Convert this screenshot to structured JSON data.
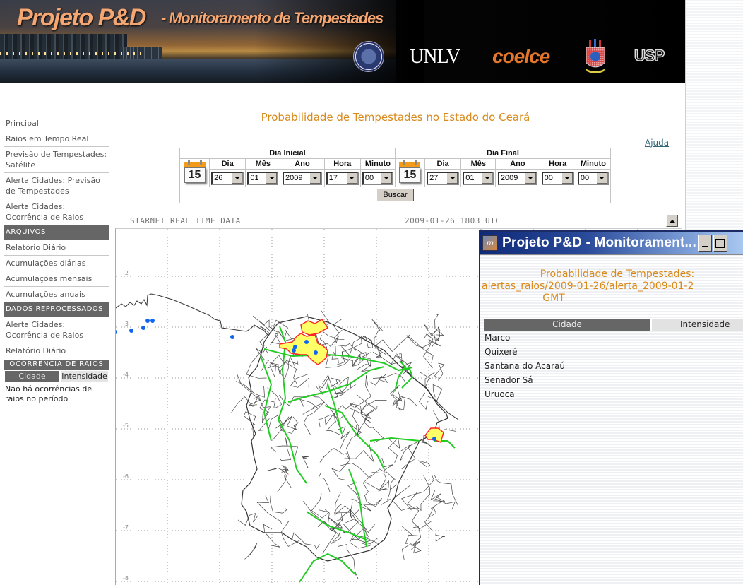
{
  "banner": {
    "title": "Projeto P&D",
    "subtitle": "- Monitoramento de Tempestades",
    "logos": [
      "UConn seal",
      "UNLV",
      "coelce",
      "UFC crest",
      "USP"
    ],
    "logo_unlv": "UNLV",
    "logo_coelce": "coelce",
    "logo_usp": "USP"
  },
  "sidebar": {
    "items": [
      {
        "label": "Principal"
      },
      {
        "label": "Raios em Tempo Real"
      },
      {
        "label": "Previsão de Tempestades: Satélite"
      },
      {
        "label": "Alerta Cidades: Previsão de Tempestades"
      },
      {
        "label": "Alerta Cidades: Ocorrência de Raios"
      }
    ],
    "section_arquivos": "ARQUIVOS",
    "arquivos_items": [
      {
        "label": "Relatório Diário"
      },
      {
        "label": "Acumulações diárias"
      },
      {
        "label": "Acumulações mensais"
      },
      {
        "label": "Acumulações anuais"
      }
    ],
    "section_reprocessados": "DADOS REPROCESSADOS",
    "reprocessados_items": [
      {
        "label": "Alerta Cidades: Ocorrência de Raios"
      },
      {
        "label": "Relatório Diário"
      }
    ],
    "ocorrencia": {
      "header": "OCORRÊNCIA DE RAIOS",
      "col_cidade": "Cidade",
      "col_intensidade": "Intensidade",
      "empty_message": "Não há ocorrências de raios no período"
    }
  },
  "main": {
    "title": "Probabilidade de Tempestades no Estado do Ceará",
    "help_link": "Ajuda",
    "form": {
      "start_label": "Dia Inicial",
      "end_label": "Dia Final",
      "calendar_icon_day": "15",
      "columns": [
        "Dia",
        "Mês",
        "Ano",
        "Hora",
        "Minuto"
      ],
      "start": {
        "dia": "26",
        "mes": "01",
        "ano": "2009",
        "hora": "17",
        "minuto": "00"
      },
      "end": {
        "dia": "27",
        "mes": "01",
        "ano": "2009",
        "hora": "00",
        "minuto": "00"
      },
      "search_button": "Buscar"
    }
  },
  "map": {
    "header_left": "STARNET REAL TIME DATA",
    "header_right": "2009-01-26 1803 UTC",
    "lat_labels": [
      "-2",
      "-3",
      "-4",
      "-5",
      "-6",
      "-7",
      "-8"
    ],
    "colors": {
      "alert_fill": "#ffff66",
      "alert_border": "#ff2222",
      "strike": "#1166ee",
      "roads": "#22cc22",
      "borders": "#333333",
      "grid": "#999999"
    }
  },
  "popup": {
    "window_title": "Projeto P&D - Monitorament...",
    "title_line1": "Probabilidade de Tempestades:",
    "title_line2": "alertas_raios/2009-01-26/alerta_2009-01-2",
    "title_line3": "GMT",
    "col_cidade": "Cidade",
    "col_intensidade": "Intensidade",
    "rows": [
      {
        "cidade": "Marco",
        "intensidade": ""
      },
      {
        "cidade": "Quixeré",
        "intensidade": ""
      },
      {
        "cidade": "Santana do Acaraú",
        "intensidade": ""
      },
      {
        "cidade": "Senador Sá",
        "intensidade": ""
      },
      {
        "cidade": "Uruoca",
        "intensidade": ""
      }
    ]
  }
}
